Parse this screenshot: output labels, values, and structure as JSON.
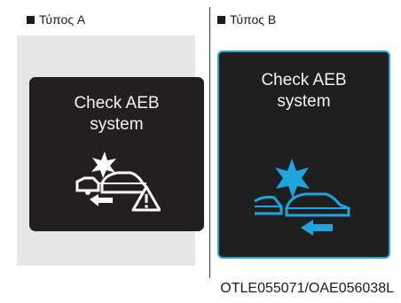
{
  "types": {
    "a": {
      "label": "Τύπος A",
      "message_line1": "Check AEB",
      "message_line2": "system"
    },
    "b": {
      "label": "Τύπος B",
      "message_line1": "Check AEB",
      "message_line2": "system"
    }
  },
  "image_code": "OTLE055071/OAE056038L",
  "icons": {
    "a": "aeb-warning-icon",
    "b": "aeb-collision-icon"
  },
  "colors": {
    "screen_dark": "#231f20",
    "accent_blue": "#2aa7e0",
    "icon_blue": "#1fa6e0"
  }
}
